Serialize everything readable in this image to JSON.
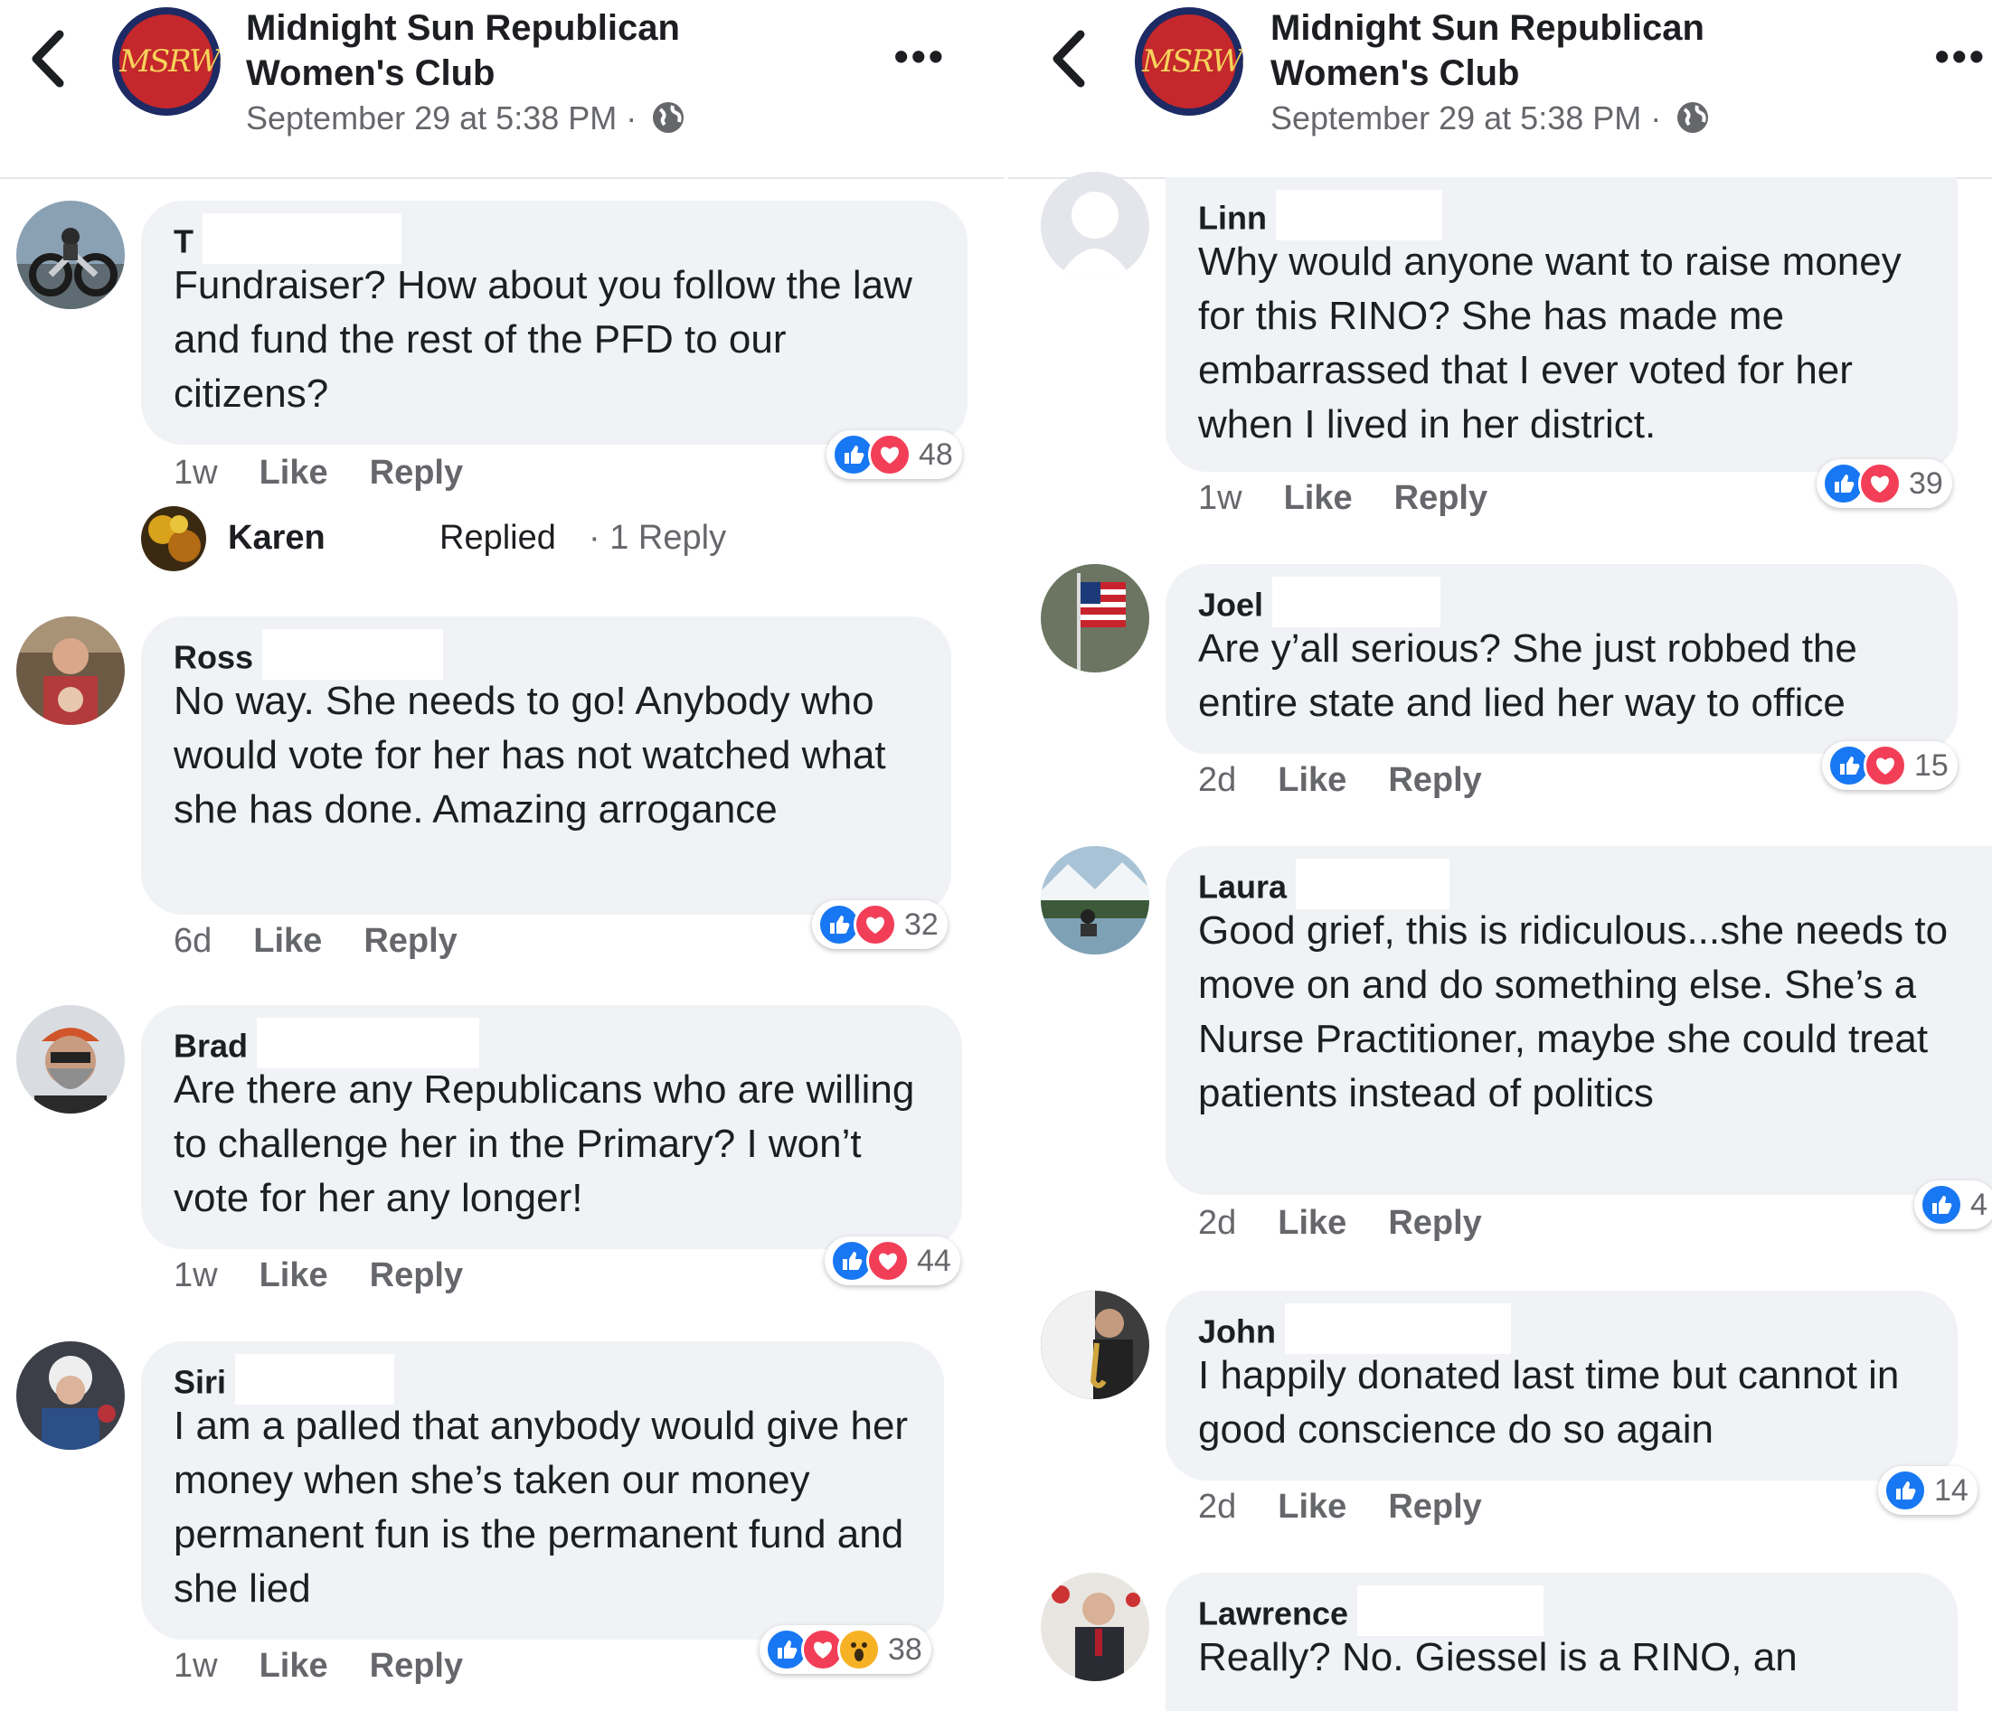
{
  "page": {
    "name": "Midnight Sun Republican Women's Club",
    "avatar_text": "MSRWC",
    "timestamp": "September 29 at 5:38 PM",
    "separator": "·"
  },
  "colors": {
    "like": "#1877f2",
    "love": "#f33e58",
    "wow": "#f7b125",
    "bubble": "#f0f2f5",
    "secondary_text": "#65676b"
  },
  "labels": {
    "like": "Like",
    "reply": "Reply"
  },
  "left_comments": [
    {
      "author": "T",
      "text": "Fundraiser? How about you follow the law and fund the rest of the PFD to our citizens?",
      "time": "1w",
      "reactions": [
        "like",
        "love"
      ],
      "count": "48"
    },
    {
      "author": "Ross",
      "text": "No way. She needs to go! Anybody who would vote for her has not watched what she has done. Amazing arrogance",
      "time": "6d",
      "reactions": [
        "like",
        "love"
      ],
      "count": "32"
    },
    {
      "author": "Brad",
      "text": "Are there any Republicans who are willing to challenge her in the Primary? I won’t vote for her any longer!",
      "time": "1w",
      "reactions": [
        "like",
        "love"
      ],
      "count": "44"
    },
    {
      "author": "Siri",
      "text": "I am a palled that anybody would give her money when she’s taken our money permanent fun is the permanent fund and she lied",
      "time": "1w",
      "reactions": [
        "like",
        "love",
        "wow"
      ],
      "count": "38"
    }
  ],
  "reply_summary": {
    "name": "Karen",
    "replied": "Replied",
    "dot": "·",
    "count": "1 Reply"
  },
  "right_comments": [
    {
      "author": "Linn",
      "text": "Why would anyone want to raise money for this RINO? She has made me embarrassed that I ever voted for her when I lived in her district.",
      "time": "1w",
      "reactions": [
        "like",
        "love"
      ],
      "count": "39"
    },
    {
      "author": "Joel",
      "text": "Are y’all serious? She just robbed the entire state and lied her way to office",
      "time": "2d",
      "reactions": [
        "like",
        "love"
      ],
      "count": "15"
    },
    {
      "author": "Laura",
      "text": "Good grief, this is ridiculous...she needs to move on and do something else.  She’s a Nurse Practitioner, maybe she could treat patients instead of politics",
      "time": "2d",
      "reactions": [
        "like"
      ],
      "count": "4"
    },
    {
      "author": "John",
      "text": "I happily donated last time but cannot in good conscience do so again",
      "time": "2d",
      "reactions": [
        "like"
      ],
      "count": "14"
    },
    {
      "author": "Lawrence",
      "text": "Really?  No.  Giessel is a RINO, an",
      "time": "",
      "reactions": [],
      "count": ""
    }
  ]
}
